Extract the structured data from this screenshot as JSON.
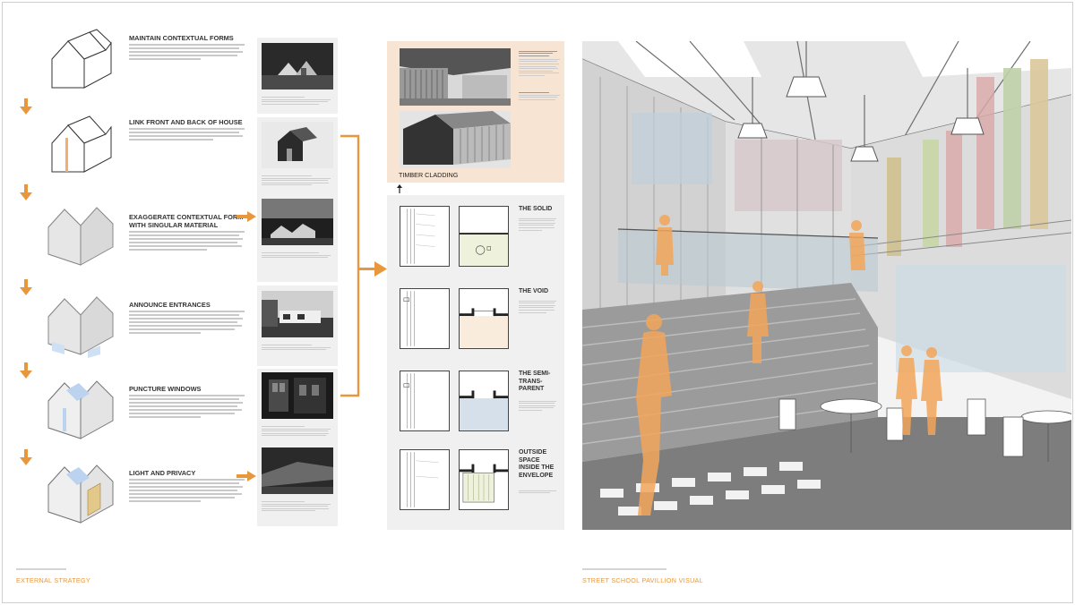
{
  "steps": [
    {
      "title": "MAINTAIN CONTEXTUAL FORMS"
    },
    {
      "title": "LINK FRONT AND BACK OF HOUSE"
    },
    {
      "title": "EXAGGERATE CONTEXTUAL FORM WITH SINGULAR MATERIAL"
    },
    {
      "title": "ANNOUNCE ENTRANCES"
    },
    {
      "title": "PUNCTURE WINDOWS"
    },
    {
      "title": "LIGHT AND PRIVACY"
    }
  ],
  "detail": {
    "timber_label": "TIMBER CLADDING",
    "rows": [
      {
        "title": "THE SOLID"
      },
      {
        "title": "THE VOID"
      },
      {
        "title": "THE SEMI-TRANS-PARENT"
      },
      {
        "title": "OUTSIDE SPACE INSIDE THE ENVELOPE"
      }
    ]
  },
  "footer": {
    "left_title": "EXTERNAL STRATEGY",
    "right_title": "STREET SCHOOL PAVILLION VISUAL"
  },
  "colors": {
    "accent": "#e8973d",
    "timber_panel": "#f7e4d2",
    "panel_grey": "#f0f0f0"
  }
}
